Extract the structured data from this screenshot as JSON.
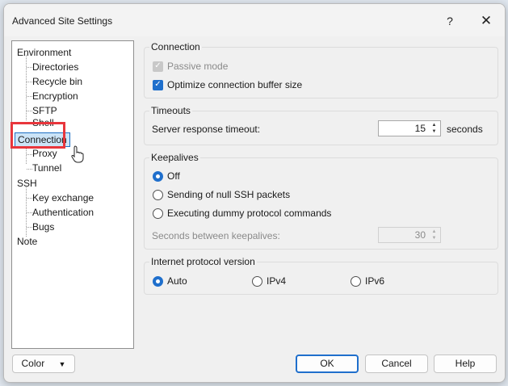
{
  "window": {
    "title": "Advanced Site Settings",
    "help_glyph": "?",
    "close_glyph": "✕"
  },
  "tree": {
    "items": [
      {
        "label": "Environment",
        "level": 1
      },
      {
        "label": "Directories",
        "level": 2
      },
      {
        "label": "Recycle bin",
        "level": 2
      },
      {
        "label": "Encryption",
        "level": 2
      },
      {
        "label": "SFTP",
        "level": 2
      },
      {
        "label": "Shell",
        "level": 2
      },
      {
        "label": "Connection",
        "level": 1,
        "selected": true
      },
      {
        "label": "Proxy",
        "level": 2
      },
      {
        "label": "Tunnel",
        "level": 2
      },
      {
        "label": "SSH",
        "level": 1
      },
      {
        "label": "Key exchange",
        "level": 2
      },
      {
        "label": "Authentication",
        "level": 2
      },
      {
        "label": "Bugs",
        "level": 2
      },
      {
        "label": "Note",
        "level": 1
      }
    ]
  },
  "connection": {
    "title": "Connection",
    "passive_mode": {
      "label": "Passive mode",
      "checked": true,
      "enabled": false
    },
    "optimize_buffer": {
      "label": "Optimize connection buffer size",
      "checked": true
    }
  },
  "timeouts": {
    "title": "Timeouts",
    "server_response_label": "Server response timeout:",
    "value": "15",
    "unit": "seconds"
  },
  "keepalives": {
    "title": "Keepalives",
    "options": [
      "Off",
      "Sending of null SSH packets",
      "Executing dummy protocol commands"
    ],
    "selected": "Off",
    "seconds_label": "Seconds between keepalives:",
    "seconds_value": "30"
  },
  "ip_version": {
    "title": "Internet protocol version",
    "options": [
      "Auto",
      "IPv4",
      "IPv6"
    ],
    "selected": "Auto"
  },
  "buttons": {
    "color": "Color",
    "ok": "OK",
    "cancel": "Cancel",
    "help": "Help"
  },
  "colors": {
    "accent": "#1f6fcc",
    "selection": "#cce4f7",
    "highlight_box": "#e8363c"
  }
}
